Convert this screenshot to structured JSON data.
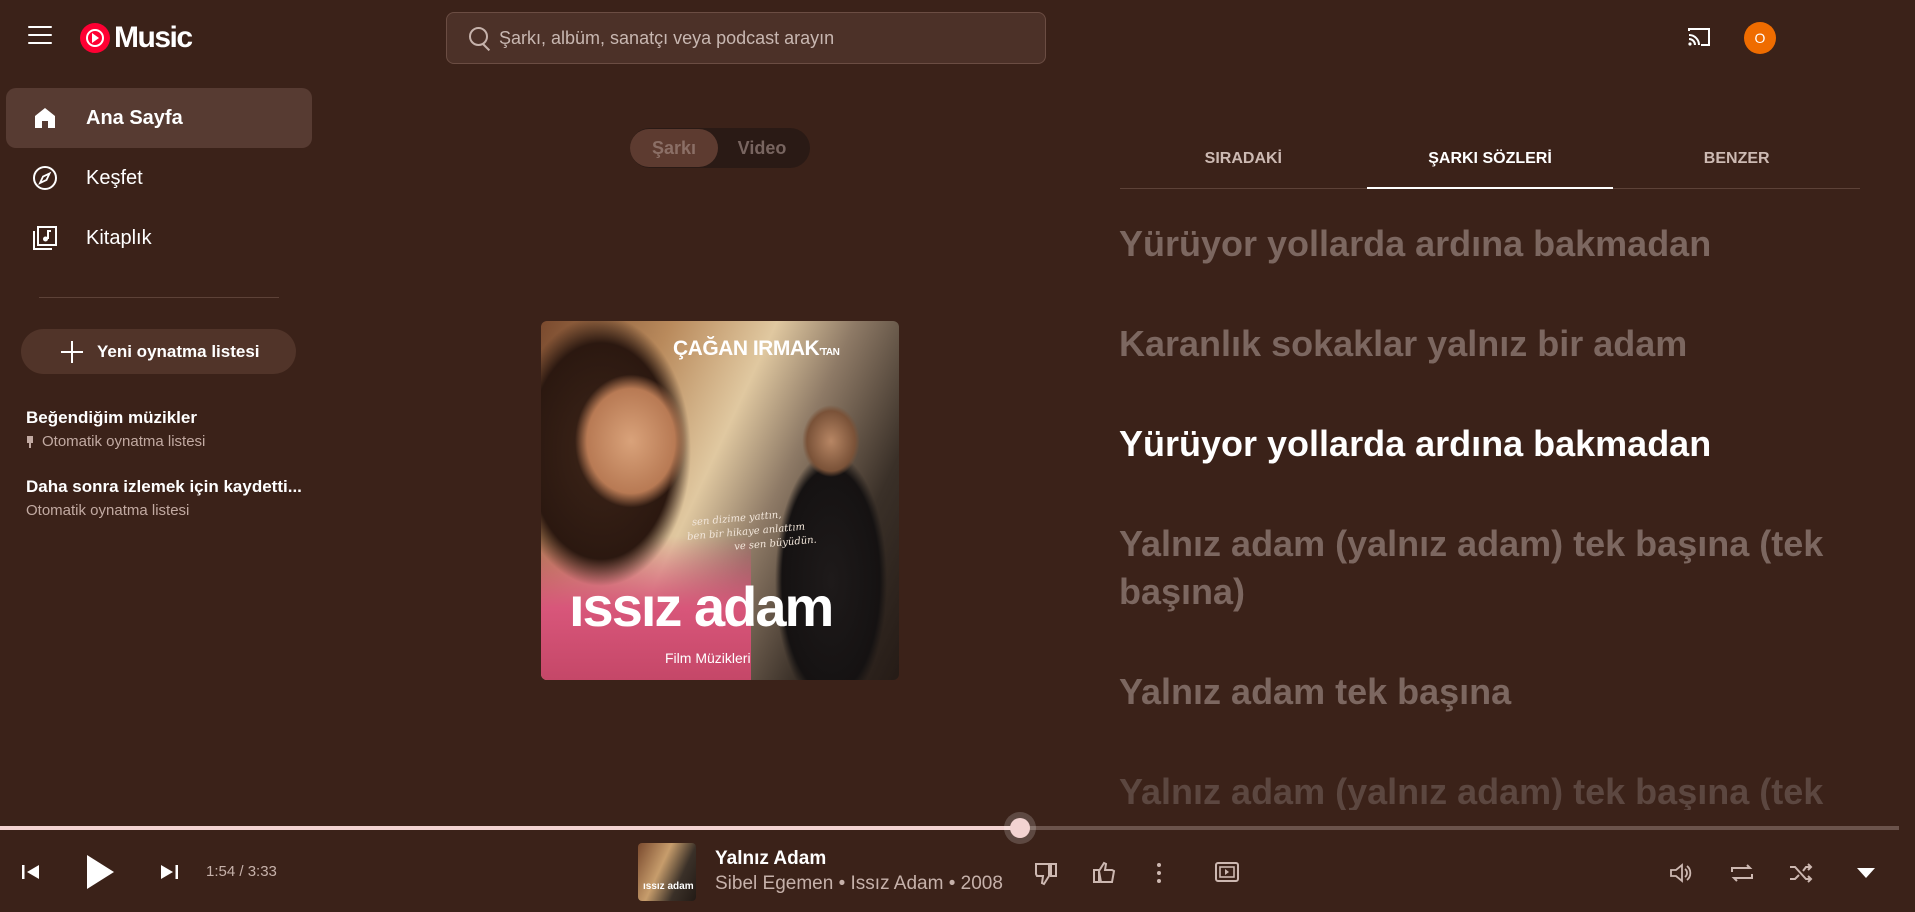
{
  "app": {
    "logo_text": "Music",
    "brand_color": "#ff0033"
  },
  "search": {
    "placeholder": "Şarkı, albüm, sanatçı veya podcast arayın"
  },
  "account": {
    "avatar_letter": "O",
    "avatar_color": "#ef6c00"
  },
  "sidebar": {
    "items": [
      {
        "label": "Ana Sayfa",
        "icon": "home-icon",
        "active": true
      },
      {
        "label": "Keşfet",
        "icon": "explore-icon",
        "active": false
      },
      {
        "label": "Kitaplık",
        "icon": "library-icon",
        "active": false
      }
    ],
    "new_playlist_label": "Yeni oynatma listesi",
    "playlists": [
      {
        "title": "Beğendiğim müzikler",
        "subtitle": "Otomatik oynatma listesi",
        "pinned": true
      },
      {
        "title": "Daha sonra izlemek için kaydetti...",
        "subtitle": "Otomatik oynatma listesi",
        "pinned": false
      }
    ]
  },
  "mode_toggle": {
    "song_label": "Şarkı",
    "video_label": "Video",
    "selected": "Şarkı"
  },
  "album_art": {
    "credit": "ÇAĞAN IRMAK",
    "credit_suffix": "'TAN",
    "quote_lines": [
      "sen dizime yattın,",
      "ben bir hikaye anlattım",
      "ve sen büyüdün."
    ],
    "title": "ıssız adam",
    "subtitle": "Film Müzikleri"
  },
  "right_panel": {
    "tabs": [
      {
        "label": "SIRADAKİ",
        "active": false
      },
      {
        "label": "ŞARKI SÖZLERİ",
        "active": true
      },
      {
        "label": "BENZER",
        "active": false
      }
    ],
    "lyrics": [
      {
        "text": "Yürüyor yollarda ardına bakmadan",
        "state": "past"
      },
      {
        "text": "Karanlık sokaklar yalnız bir adam",
        "state": "past"
      },
      {
        "text": "Yürüyor yollarda ardına bakmadan",
        "state": "current"
      },
      {
        "text": "Yalnız adam (yalnız adam) tek başına (tek başına)",
        "state": "upcoming"
      },
      {
        "text": "Yalnız adam tek başına",
        "state": "upcoming"
      },
      {
        "text": "Yalnız adam (yalnız adam) tek başına (tek",
        "state": "fade"
      }
    ]
  },
  "player": {
    "time_text": "1:54 / 3:33",
    "progress_fraction": 0.537,
    "progress_color": "#f3d3d1",
    "track": {
      "title": "Yalnız Adam",
      "artist": "Sibel Egemen",
      "album": "Issız Adam",
      "year": "2008",
      "separator": " • ",
      "art_text": "ıssız adam"
    }
  }
}
